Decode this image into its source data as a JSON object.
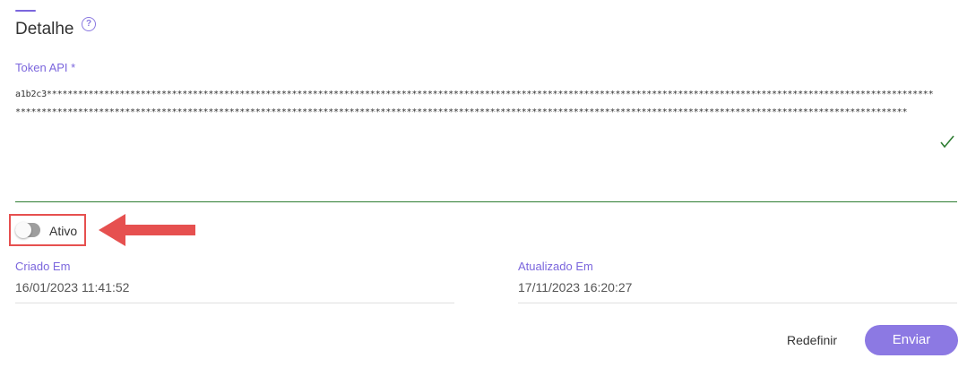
{
  "header": {
    "title": "Detalhe",
    "help_icon": "question-circle-icon"
  },
  "token": {
    "label": "Token API *",
    "value": "a1b2c3*****************************************************************************************************************************************************************************************************************************************************************************************************************************************************",
    "valid_icon": "checkmark-icon",
    "valid_color": "#2e7d32"
  },
  "status": {
    "toggle_label": "Ativo",
    "toggle_on": false
  },
  "dates": {
    "created_label": "Criado Em",
    "created_value": "16/01/2023 11:41:52",
    "updated_label": "Atualizado Em",
    "updated_value": "17/11/2023 16:20:27"
  },
  "actions": {
    "reset_label": "Redefinir",
    "submit_label": "Enviar"
  },
  "colors": {
    "accent": "#7b66dd",
    "highlight": "#e6504f",
    "button": "#8c79e3"
  }
}
